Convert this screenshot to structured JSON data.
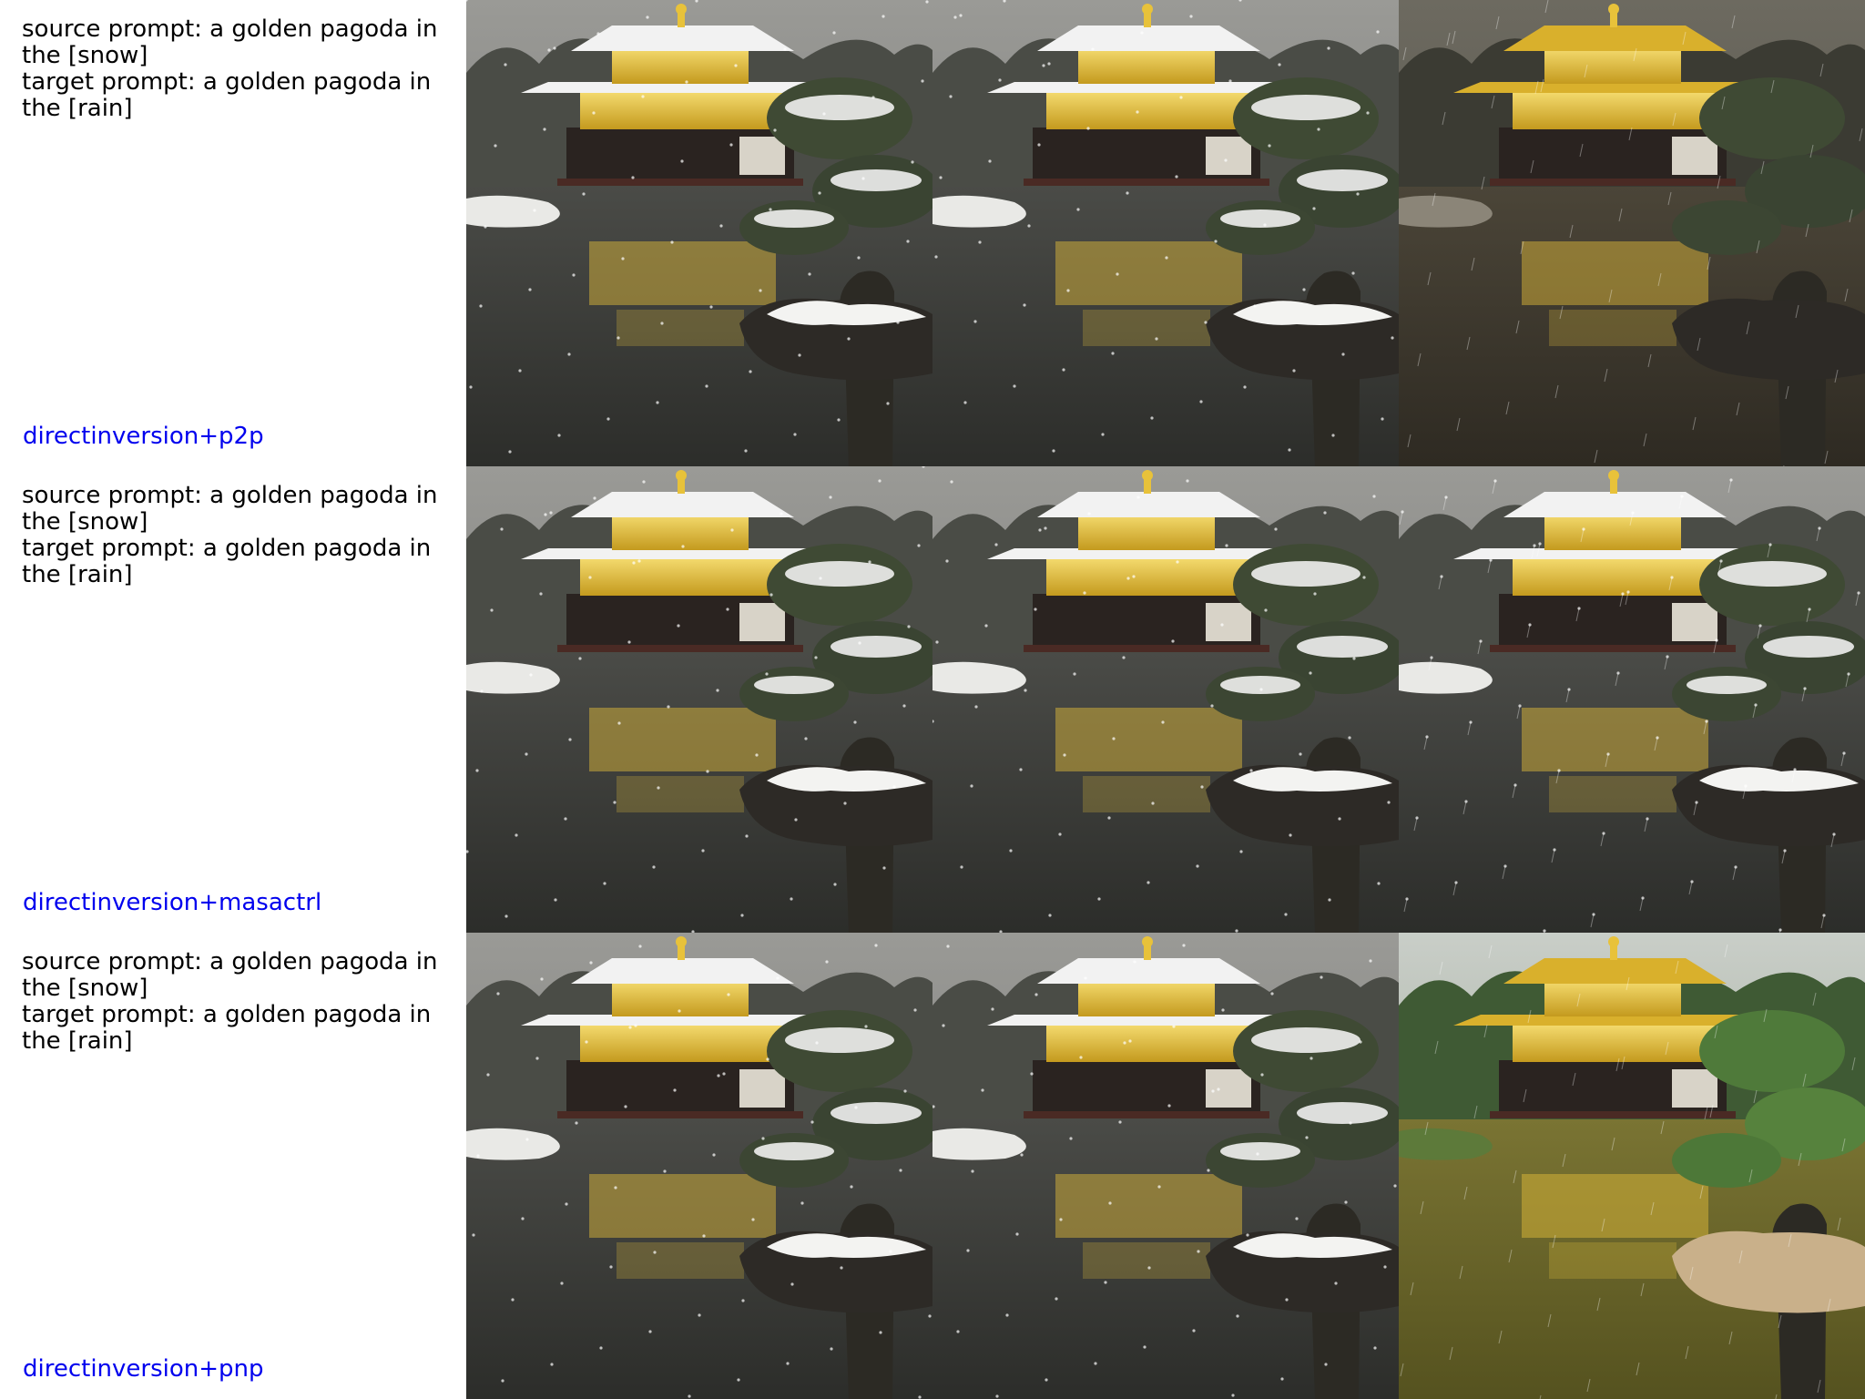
{
  "rows": [
    {
      "source_prompt": "source prompt: a golden pagoda in the [snow]",
      "target_prompt": "target prompt: a golden pagoda in the [rain]",
      "method": "directinversion+p2p"
    },
    {
      "source_prompt": "source prompt: a golden pagoda in the [snow]",
      "target_prompt": "target prompt: a golden pagoda in the [rain]",
      "method": "directinversion+masactrl"
    },
    {
      "source_prompt": "source prompt: a golden pagoda in the [snow]",
      "target_prompt": "target prompt: a golden pagoda in the [rain]",
      "method": "directinversion+pnp"
    }
  ],
  "colors": {
    "method_text": "#0000ee",
    "prompt_text": "#000000",
    "gold": "#e8c23a",
    "snow": "#f2f2f2",
    "water_dark": "#3a3c38",
    "water_green": "#6f6a2e"
  }
}
